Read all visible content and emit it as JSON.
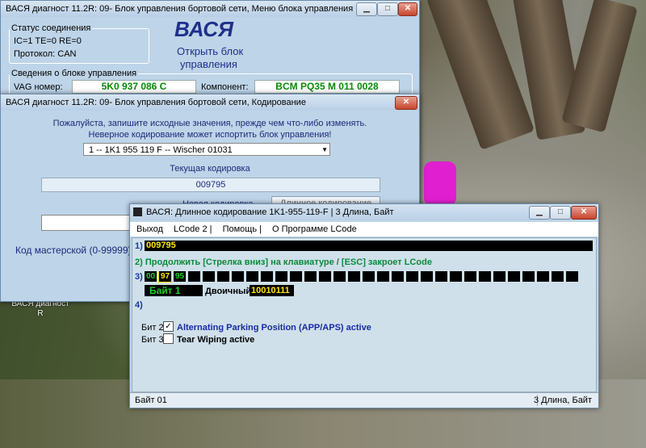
{
  "desktop": {
    "icon_label": "ВАСЯ диагност R"
  },
  "main_window": {
    "title": "ВАСЯ диагност 11.2R: 09- Блок управления бортовой сети,  Меню блока управления",
    "status_group": {
      "legend": "Статус соединения",
      "line1": "IC=1  TE=0   RE=0",
      "line2": "Протокол: CAN"
    },
    "brand": {
      "name": "ВАСЯ",
      "subtitle1": "Открыть блок",
      "subtitle2": "управления"
    },
    "info_group": {
      "legend": "Сведения о блоке управления",
      "vag_label": "VAG номер:",
      "vag_value": "5K0 937 086 C",
      "component_label": "Компонент:",
      "component_value": "BCM PQ35 M     011 0028"
    }
  },
  "coding_window": {
    "title": "ВАСЯ диагност 11.2R: 09- Блок управления бортовой сети,  Кодирование",
    "warning1": "Пожалуйста, запишите исходные значения, прежде чем что-либо изменять.",
    "warning2": "Неверное кодирование может испортить блок управления!",
    "select_value": "1 -- 1K1 955 119 F -- Wischer 01031",
    "current_label": "Текущая кодировка",
    "current_value": "009795",
    "new_label": "Новая кодировка",
    "long_coding_button": "Длинное кодирование",
    "workshop_label": "Код мастерской (0-99999):"
  },
  "lcode_window": {
    "title": "ВАСЯ: Длинное кодирование  1K1-955-119-F | 3 Длина, Байт",
    "menu": [
      "Выход",
      "LCode 2 |",
      "Помощь |",
      "О Программе LCode"
    ],
    "row1_label": "1)",
    "row1_value": "009795",
    "row2": "2) Продолжить [Стрелка вниз] на клавиатуре / [ESC] закроет LCode",
    "row3_label": "3)",
    "bytes": [
      "00",
      "97",
      "95"
    ],
    "byte_label": "Байт 1",
    "binary_label": "Двоичный:",
    "binary_value": "10010111",
    "row4_label": "4)",
    "bits": [
      {
        "label": "Бит 2",
        "checked": true,
        "text": "Alternating Parking Position (APP/APS) active"
      },
      {
        "label": "Бит 3",
        "checked": false,
        "text": "Tear Wiping active"
      }
    ],
    "status_left": "Байт 01",
    "status_right": "3 Длина, Байт"
  }
}
